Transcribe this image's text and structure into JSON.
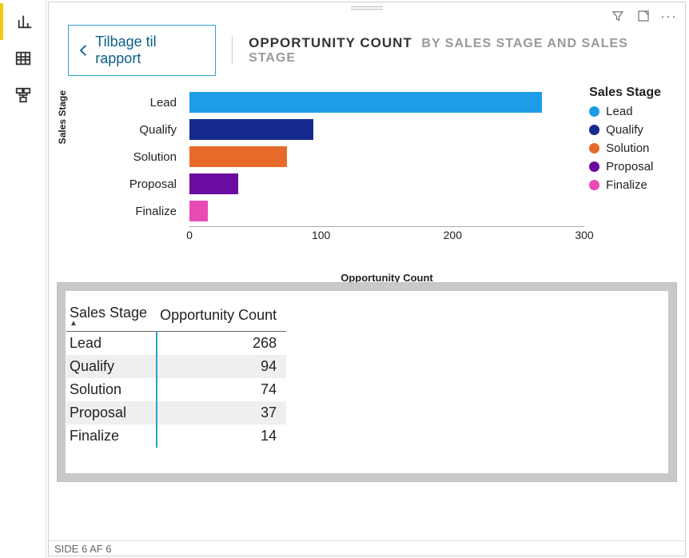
{
  "nav": {
    "items": [
      "chart-view",
      "table-view",
      "model-view"
    ],
    "active": 0
  },
  "header": {
    "back_label": "Tilbage til rapport",
    "title_main": "OPPORTUNITY COUNT",
    "title_sub": "BY SALES STAGE AND SALES STAGE"
  },
  "legend": {
    "title": "Sales Stage",
    "items": [
      {
        "name": "Lead",
        "color": "#1e9ce8"
      },
      {
        "name": "Qualify",
        "color": "#142a8e"
      },
      {
        "name": "Solution",
        "color": "#e86a2a"
      },
      {
        "name": "Proposal",
        "color": "#6a0c9f"
      },
      {
        "name": "Finalize",
        "color": "#e84bb3"
      }
    ]
  },
  "chart_data": {
    "type": "bar",
    "orientation": "horizontal",
    "categories": [
      "Lead",
      "Qualify",
      "Solution",
      "Proposal",
      "Finalize"
    ],
    "values": [
      268,
      94,
      74,
      37,
      14
    ],
    "colors": [
      "#1e9ce8",
      "#142a8e",
      "#e86a2a",
      "#6a0c9f",
      "#e84bb3"
    ],
    "xlabel": "Opportunity Count",
    "ylabel": "Sales Stage",
    "xlim": [
      0,
      300
    ],
    "xticks": [
      0,
      100,
      200,
      300
    ]
  },
  "table": {
    "columns": [
      "Sales Stage",
      "Opportunity Count"
    ],
    "sort_col": 0,
    "sort_dir": "asc",
    "rows": [
      [
        "Lead",
        268
      ],
      [
        "Qualify",
        94
      ],
      [
        "Solution",
        74
      ],
      [
        "Proposal",
        37
      ],
      [
        "Finalize",
        14
      ]
    ]
  },
  "status": {
    "page_label": "SIDE 6 AF 6"
  }
}
